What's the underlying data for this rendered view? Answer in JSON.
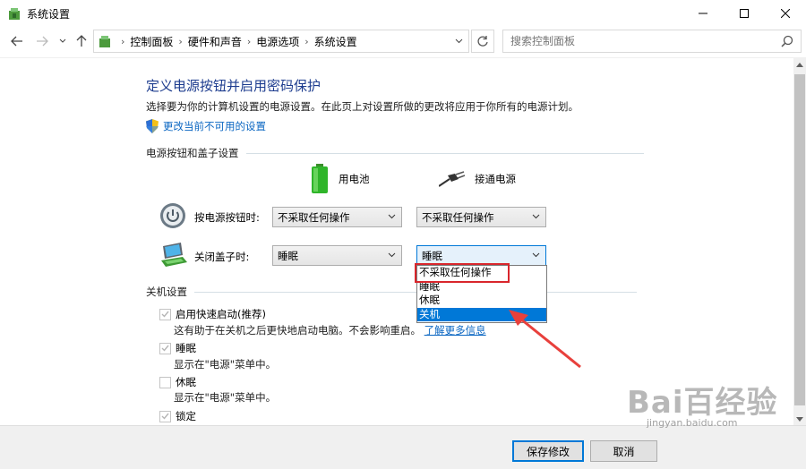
{
  "window": {
    "title": "系统设置"
  },
  "nav": {
    "breadcrumbs": [
      "控制面板",
      "硬件和声音",
      "电源选项",
      "系统设置"
    ],
    "search_placeholder": "搜索控制面板"
  },
  "page": {
    "title": "定义电源按钮并启用密码保护",
    "description": "选择要为你的计算机设置的电源设置。在此页上对设置所做的更改将应用于你所有的电源计划。",
    "change_link": "更改当前不可用的设置"
  },
  "power_section": {
    "heading": "电源按钮和盖子设置",
    "col_battery": "用电池",
    "col_plugged": "接通电源",
    "rows": [
      {
        "label": "按电源按钮时:",
        "battery": "不采取任何操作",
        "plugged": "不采取任何操作"
      },
      {
        "label": "关闭盖子时:",
        "battery": "睡眠",
        "plugged": "睡眠"
      }
    ],
    "dropdown_options": [
      "不采取任何操作",
      "睡眠",
      "休眠",
      "关机"
    ],
    "dropdown_selected_index": 3
  },
  "shutdown_section": {
    "heading": "关机设置",
    "items": [
      {
        "label": "启用快速启动(推荐)",
        "checked": true,
        "disabled": true,
        "desc": "这有助于在关机之后更快地启动电脑。不会影响重启。",
        "link": "了解更多信息"
      },
      {
        "label": "睡眠",
        "checked": true,
        "disabled": true,
        "desc": "显示在\"电源\"菜单中。"
      },
      {
        "label": "休眠",
        "checked": false,
        "disabled": true,
        "desc": "显示在\"电源\"菜单中。"
      },
      {
        "label": "锁定",
        "checked": true,
        "disabled": true
      }
    ]
  },
  "footer": {
    "save_label": "保存修改",
    "cancel_label": "取消"
  },
  "watermark": {
    "main": "Bai百经验",
    "sub": "jingyan.baidu.com"
  },
  "colors": {
    "title_blue": "#1e3d8f",
    "link_blue": "#0a66c2",
    "selection_blue": "#0078d7",
    "annotation_red": "#d9262c"
  }
}
